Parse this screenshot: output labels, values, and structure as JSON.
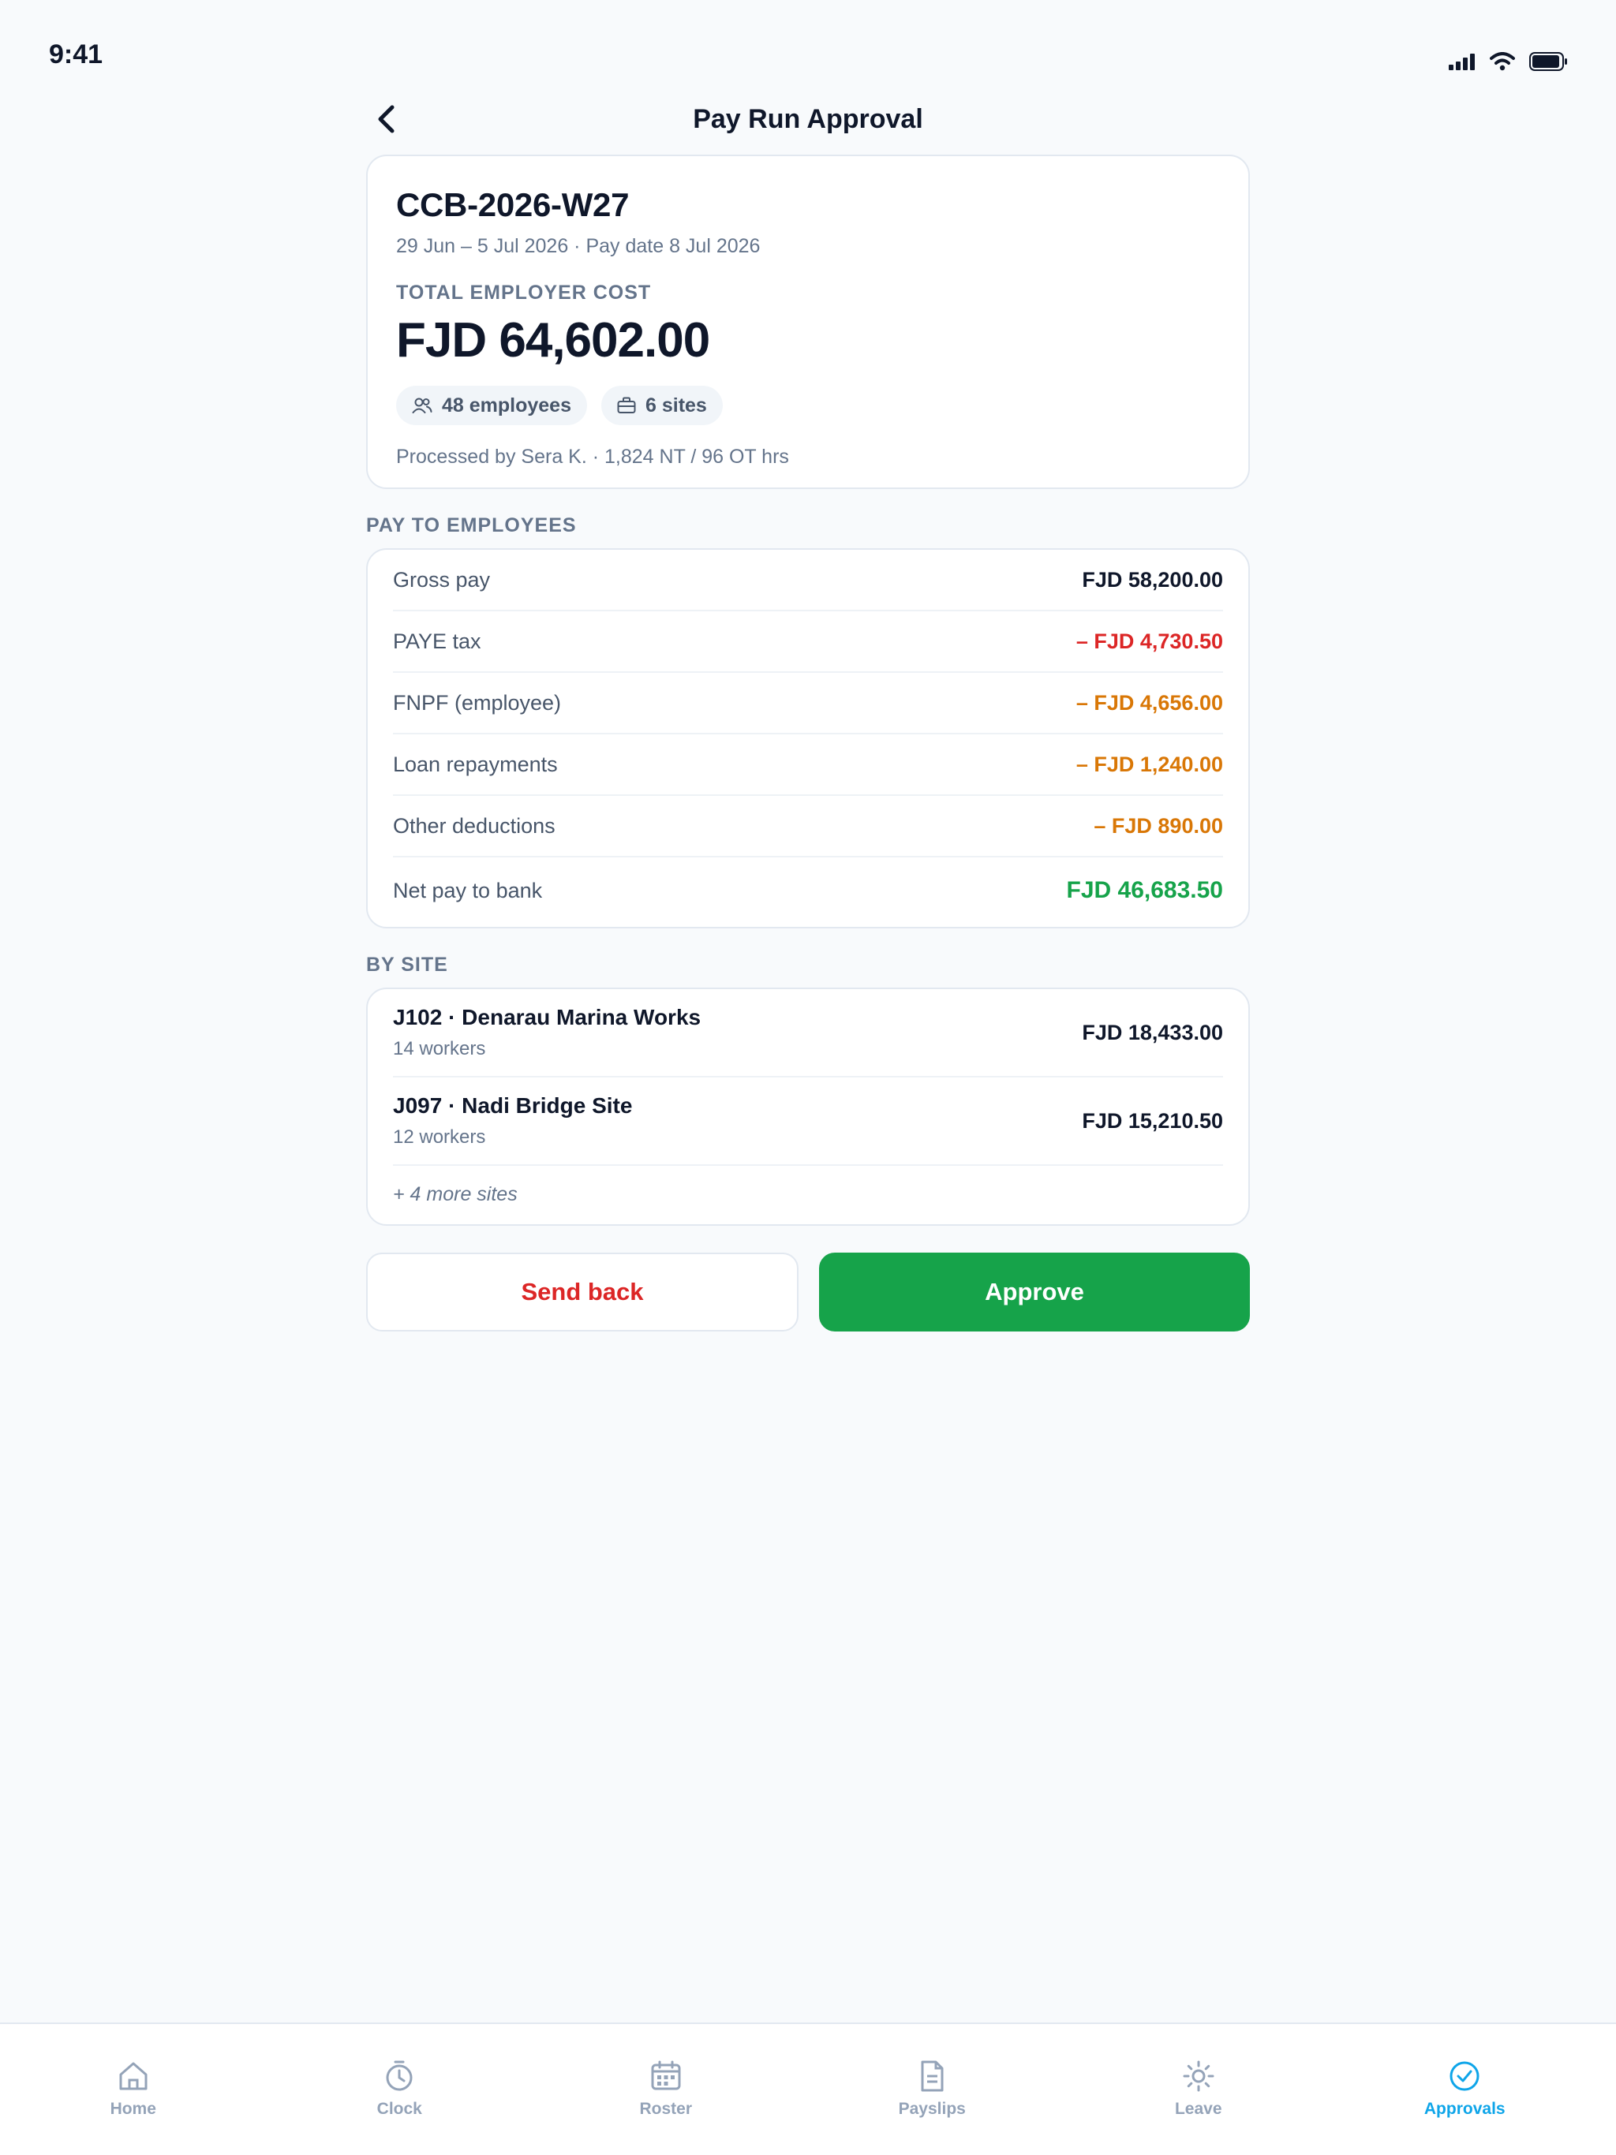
{
  "status_bar": {
    "time": "9:41"
  },
  "header": {
    "title": "Pay Run Approval"
  },
  "summary": {
    "run_id": "CCB-2026-W27",
    "period": "29 Jun – 5 Jul 2026 · Pay date 8 Jul 2026",
    "cost_label": "TOTAL EMPLOYER COST",
    "cost_value": "FJD 64,602.00",
    "employees_chip": "48 employees",
    "sites_chip": "6 sites",
    "processed": "Processed by Sera K. · 1,824 NT / 96 OT hrs"
  },
  "pay_section": {
    "label": "PAY TO EMPLOYEES",
    "rows": [
      {
        "label": "Gross pay",
        "value": "FJD 58,200.00"
      },
      {
        "label": "PAYE tax",
        "value": "– FJD 4,730.50"
      },
      {
        "label": "FNPF (employee)",
        "value": "– FJD 4,656.00"
      },
      {
        "label": "Loan repayments",
        "value": "– FJD 1,240.00"
      },
      {
        "label": "Other deductions",
        "value": "– FJD 890.00"
      },
      {
        "label": "Net pay to bank",
        "value": "FJD 46,683.50"
      }
    ]
  },
  "site_section": {
    "label": "BY SITE",
    "sites": [
      {
        "name": "J102 · Denarau Marina Works",
        "workers": "14 workers",
        "value": "FJD 18,433.00"
      },
      {
        "name": "J097 · Nadi Bridge Site",
        "workers": "12 workers",
        "value": "FJD 15,210.50"
      }
    ],
    "more": "+ 4 more sites"
  },
  "actions": {
    "send_back": "Send back",
    "approve": "Approve"
  },
  "tabs": [
    {
      "label": "Home",
      "icon": "home-icon"
    },
    {
      "label": "Clock",
      "icon": "clock-icon"
    },
    {
      "label": "Roster",
      "icon": "calendar-icon"
    },
    {
      "label": "Payslips",
      "icon": "document-icon"
    },
    {
      "label": "Leave",
      "icon": "sun-icon"
    },
    {
      "label": "Approvals",
      "icon": "check-circle-icon"
    }
  ],
  "colors": {
    "accent": "#0ea5e9",
    "approve": "#16a34a",
    "danger": "#dc2626",
    "warning": "#d97706"
  }
}
